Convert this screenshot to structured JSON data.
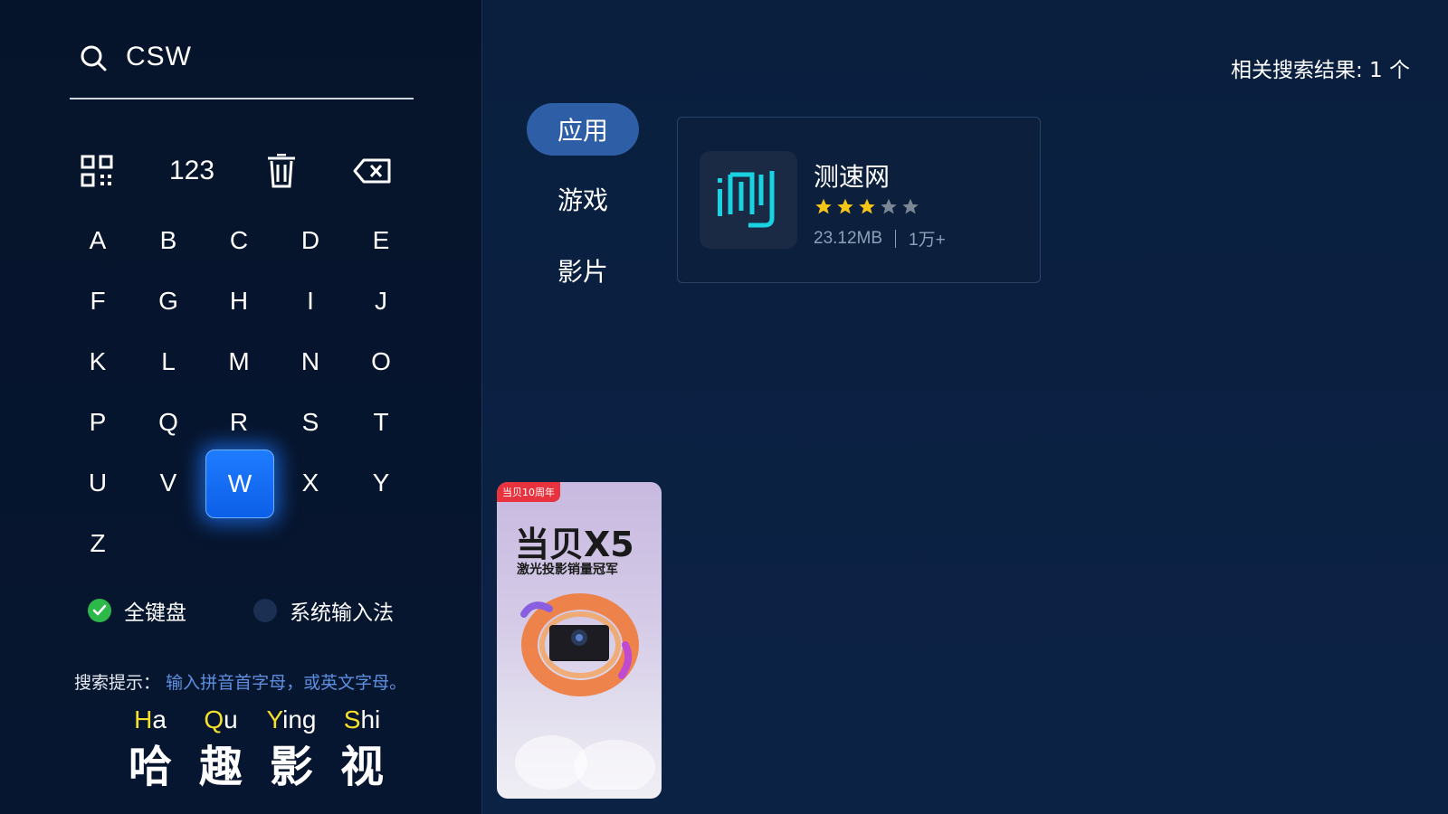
{
  "search": {
    "query": "CSW"
  },
  "keyboard": {
    "function_keys": {
      "number": "123"
    },
    "rows": [
      [
        "A",
        "B",
        "C",
        "D",
        "E"
      ],
      [
        "F",
        "G",
        "H",
        "I",
        "J"
      ],
      [
        "K",
        "L",
        "M",
        "N",
        "O"
      ],
      [
        "P",
        "Q",
        "R",
        "S",
        "T"
      ],
      [
        "U",
        "V",
        "W",
        "X",
        "Y"
      ],
      [
        "Z"
      ]
    ],
    "selected": "W"
  },
  "input_methods": {
    "full": "全键盘",
    "system": "系统输入法",
    "full_checked": true
  },
  "hint": {
    "label": "搜索提示：",
    "text": "输入拼音首字母，或英文字母。"
  },
  "brand": {
    "chars": [
      {
        "initial": "H",
        "rest": "a",
        "cn": "哈"
      },
      {
        "initial": "Q",
        "rest": "u",
        "cn": "趣"
      },
      {
        "initial": "Y",
        "rest": "ing",
        "cn": "影"
      },
      {
        "initial": "S",
        "rest": "hi",
        "cn": "视"
      }
    ]
  },
  "results": {
    "count_text": "相关搜索结果: 1 个"
  },
  "tabs": [
    {
      "label": "应用",
      "active": true
    },
    {
      "label": "游戏",
      "active": false
    },
    {
      "label": "影片",
      "active": false
    }
  ],
  "app": {
    "name": "测速网",
    "icon_glyph": "测",
    "rating": 3,
    "max_rating": 5,
    "size": "23.12MB",
    "downloads": "1万+"
  },
  "ad": {
    "badge": "当贝10周年",
    "title": "当贝X5",
    "subtitle": "激光投影销量冠军"
  },
  "colors": {
    "selected_key": "#1e7cff",
    "active_tab": "#2e5fa6",
    "star_on": "#f5c518",
    "star_off": "#7c8796",
    "brand_initial": "#f5e02c",
    "hint_accent": "#5f8fe0",
    "check_green": "#2db84a"
  }
}
